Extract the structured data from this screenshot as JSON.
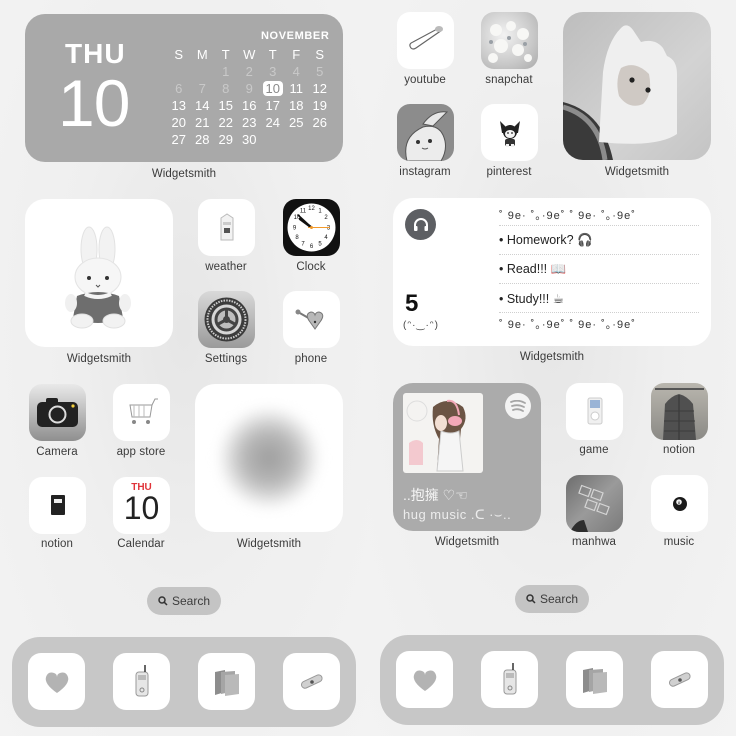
{
  "left_screen": {
    "calendar_widget": {
      "day_of_week": "THU",
      "day": "10",
      "month": "NOVEMBER",
      "weekday_headers": [
        "S",
        "M",
        "T",
        "W",
        "T",
        "F",
        "S"
      ],
      "weeks": [
        [
          "",
          "",
          "1",
          "2",
          "3",
          "4",
          "5"
        ],
        [
          "6",
          "7",
          "8",
          "9",
          "10",
          "11",
          "12"
        ],
        [
          "13",
          "14",
          "15",
          "16",
          "17",
          "18",
          "19"
        ],
        [
          "20",
          "21",
          "22",
          "23",
          "24",
          "25",
          "26"
        ],
        [
          "27",
          "28",
          "29",
          "30",
          "",
          "",
          ""
        ]
      ],
      "today": "10",
      "label": "Widgetsmith"
    },
    "photo_widget": {
      "label": "Widgetsmith",
      "image": "white bunny plush"
    },
    "apps": [
      {
        "label": "weather",
        "icon": "milk-carton-icon"
      },
      {
        "label": "Clock",
        "icon": "clock-icon"
      },
      {
        "label": "Settings",
        "icon": "gear-icon"
      },
      {
        "label": "phone",
        "icon": "heart-lock-icon"
      },
      {
        "label": "Camera",
        "icon": "camera-icon"
      },
      {
        "label": "app store",
        "icon": "shopping-cart-icon"
      },
      {
        "label": "notion",
        "icon": "notebook-icon"
      },
      {
        "label": "Calendar",
        "icon": "calendar-icon"
      }
    ],
    "calendar_icon": {
      "dow": "THU",
      "day": "10"
    },
    "blur_widget": {
      "label": "Widgetsmith"
    },
    "search_label": "Search",
    "dock": [
      "heart-icon",
      "flip-phone-icon",
      "folder-icon",
      "bandage-icon"
    ]
  },
  "right_screen": {
    "apps": [
      {
        "label": "youtube",
        "icon": "safety-pin-icon"
      },
      {
        "label": "snapchat",
        "icon": "flowers-icon"
      },
      {
        "label": "instagram",
        "icon": "bunny-icon"
      },
      {
        "label": "pinterest",
        "icon": "kuromi-icon"
      },
      {
        "label": "game",
        "icon": "ipod-icon"
      },
      {
        "label": "notion",
        "icon": "jacket-icon"
      },
      {
        "label": "manhwa",
        "icon": "hopscotch-icon"
      },
      {
        "label": "music",
        "icon": "eight-ball-icon"
      }
    ],
    "photo_widget": {
      "label": "Widgetsmith",
      "image": "white hooded figure"
    },
    "todo_widget": {
      "count": "5",
      "kaomoji": "(ᵔ·‿·ᵔ)",
      "decoration": "˚ 9e· ˚｡·9e˚ ˚ 9e· ˚｡·9e˚",
      "items": [
        "• Homework? 🎧",
        "• Read!!! 📖",
        "• Study!!! ☕"
      ],
      "label": "Widgetsmith"
    },
    "music_widget": {
      "title": "..抱擁 ♡☜",
      "subtitle": "hug music .ᑕ ·⌣..",
      "label": "Widgetsmith"
    },
    "search_label": "Search",
    "dock": [
      "heart-icon",
      "flip-phone-icon",
      "folder-icon",
      "bandage-icon"
    ]
  },
  "colors": {
    "background": "#f1f1f1",
    "widget_gray": "#a9a9a9",
    "dock_gray": "#c7c7c7",
    "search_pill": "#c4c4c4",
    "calendar_red": "#e0343a",
    "clock_second_hand": "#f39a2b"
  }
}
